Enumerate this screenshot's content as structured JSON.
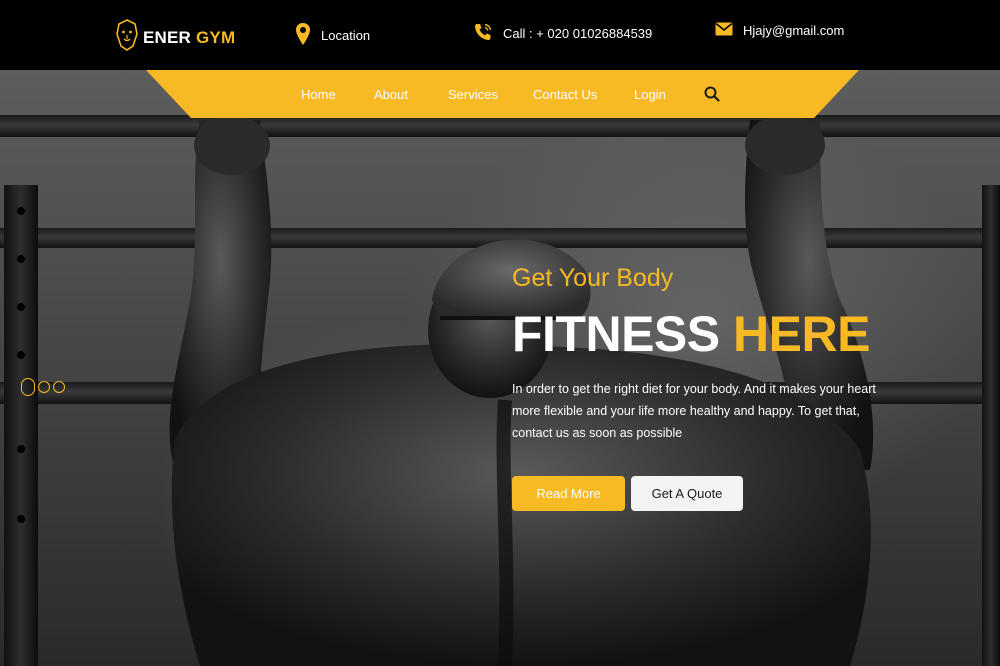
{
  "brand": {
    "name_part1": "ENER",
    "name_part2": "GYM",
    "logo_icon": "lion-head-icon"
  },
  "contact": {
    "location": {
      "icon": "map-pin-icon",
      "text": "Location"
    },
    "phone": {
      "icon": "phone-icon",
      "text": "Call : + 020 01026884539"
    },
    "email": {
      "icon": "envelope-icon",
      "text": "Hjajy@gmail.com"
    }
  },
  "nav": {
    "items": [
      "Home",
      "About",
      "Services",
      "Contact Us",
      "Login"
    ],
    "active": "Home",
    "search_icon": "search-icon"
  },
  "hero": {
    "subtitle": "Get Your Body",
    "headline_white": "FITNESS",
    "headline_accent": "HERE",
    "description": "In order to get the right diet for your body. And it makes your heart more flexible and your life more healthy and happy. To get that, contact us as soon as possible",
    "primary_button": "Read More",
    "secondary_button": "Get A Quote"
  },
  "slider": {
    "dot_count": 3,
    "active_index": 0
  },
  "colors": {
    "accent": "#f7b924",
    "topbar": "#000000",
    "text_light": "#ffffff"
  }
}
